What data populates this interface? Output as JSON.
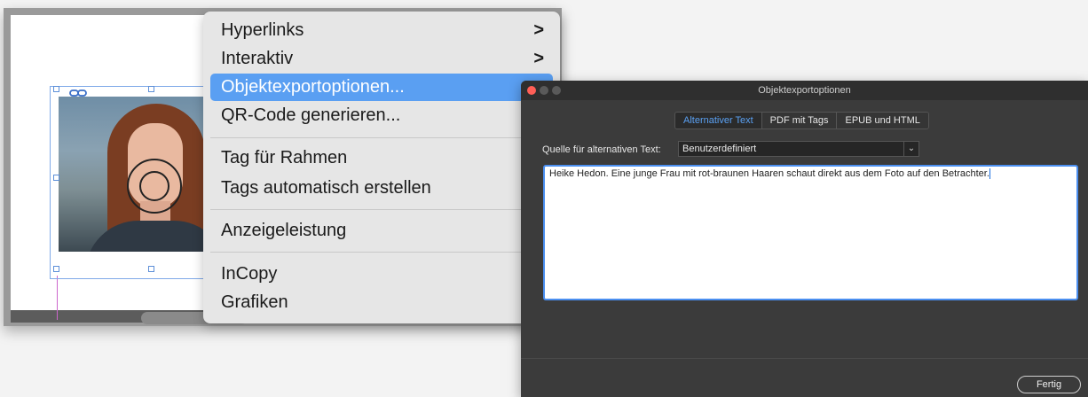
{
  "context_menu": {
    "items": [
      {
        "label": "Hyperlinks",
        "submenu": true,
        "active": false
      },
      {
        "label": "Interaktiv",
        "submenu": true,
        "active": false
      },
      {
        "label": "Objektexportoptionen...",
        "submenu": false,
        "active": true
      },
      {
        "label": "QR-Code generieren...",
        "submenu": false,
        "active": false
      },
      {
        "label": "Tag für Rahmen",
        "submenu": false,
        "active": false
      },
      {
        "label": "Tags automatisch erstellen",
        "submenu": false,
        "active": false
      },
      {
        "label": "Anzeigeleistung",
        "submenu": false,
        "active": false
      },
      {
        "label": "InCopy",
        "submenu": false,
        "active": false
      },
      {
        "label": "Grafiken",
        "submenu": false,
        "active": false
      }
    ],
    "chevron_glyph": ">"
  },
  "dialog": {
    "title": "Objektexportoptionen",
    "tabs": [
      {
        "label": "Alternativer Text",
        "active": true
      },
      {
        "label": "PDF mit Tags",
        "active": false
      },
      {
        "label": "EPUB und HTML",
        "active": false
      }
    ],
    "source_label": "Quelle für alternativen Text:",
    "source_value": "Benutzerdefiniert",
    "alt_text": "Heike Hedon. Eine junge Frau mit rot-braunen Haaren schaut direkt aus dem Foto auf den Betrachter.",
    "done_button": "Fertig"
  },
  "colors": {
    "menu_highlight": "#5a9ff2",
    "selection_frame": "#7fa9e8",
    "dialog_bg": "#3b3b3b",
    "active_tab": "#5aa0f2"
  },
  "icons": [
    "link-icon",
    "content-grabber-icon",
    "chevron-right-icon",
    "chevron-down-icon"
  ]
}
